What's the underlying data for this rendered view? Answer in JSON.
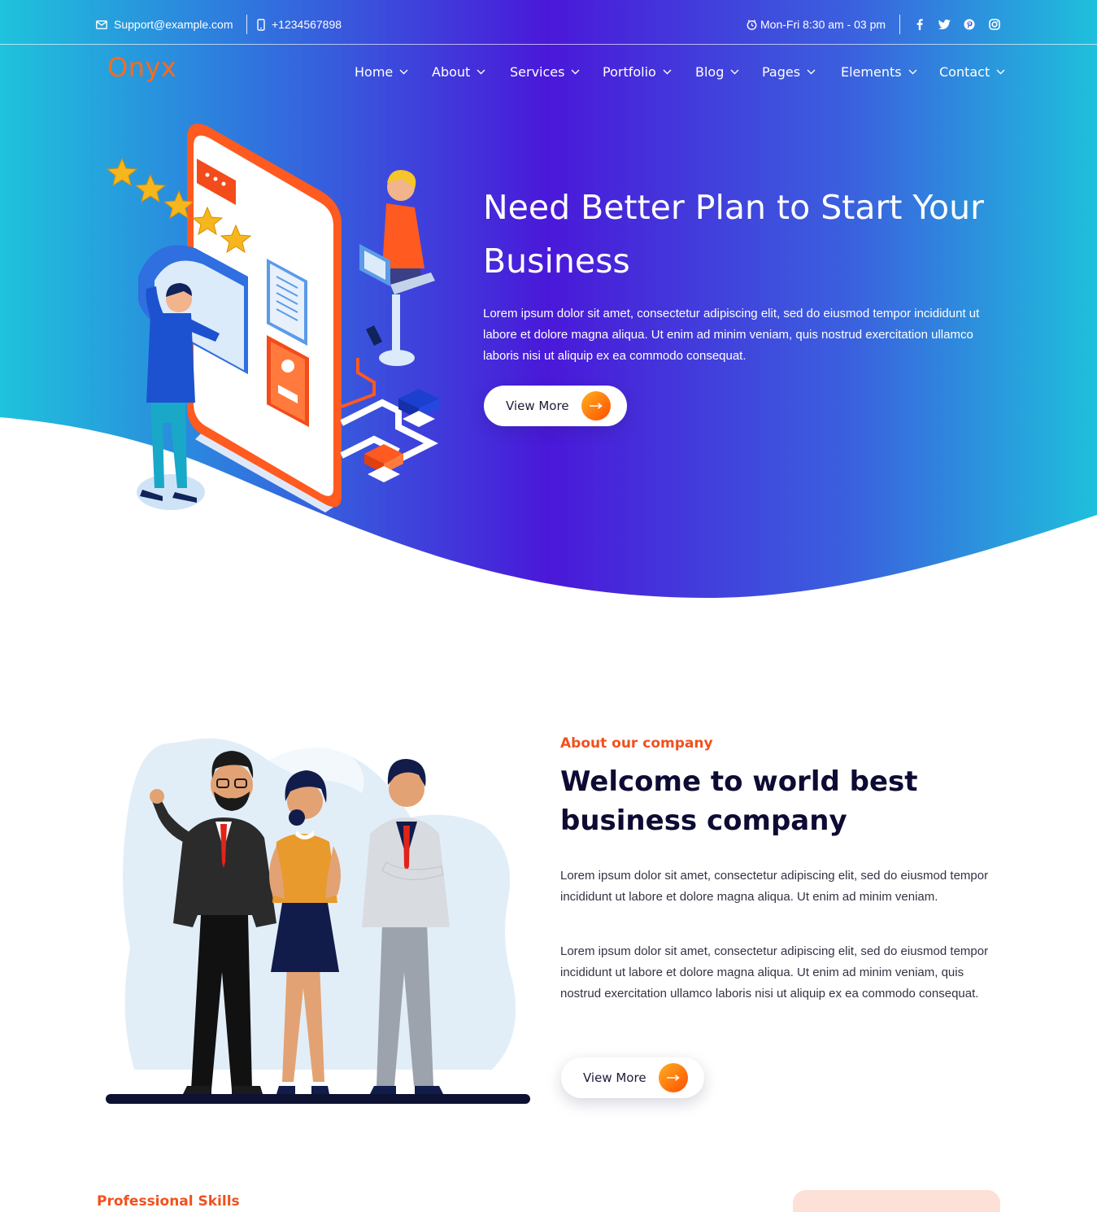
{
  "topbar": {
    "email": "Support@example.com",
    "phone": "+1234567898",
    "hours": "Mon-Fri 8:30 am - 03 pm",
    "social": [
      "facebook-icon",
      "twitter-icon",
      "pinterest-icon",
      "instagram-icon"
    ]
  },
  "logo": "Onyx",
  "nav": {
    "items": [
      {
        "label": "Home"
      },
      {
        "label": "About"
      },
      {
        "label": "Services"
      },
      {
        "label": "Portfolio"
      },
      {
        "label": "Blog"
      },
      {
        "label": "Pages"
      },
      {
        "label": "Elements"
      },
      {
        "label": "Contact"
      }
    ]
  },
  "hero": {
    "title": "Need Better Plan to Start Your Business",
    "text": "Lorem ipsum dolor sit amet, consectetur adipiscing elit, sed do eiusmod tempor incididunt ut labore et dolore magna aliqua. Ut enim ad minim veniam, quis nostrud exercitation ullamco laboris nisi ut aliquip ex ea commodo consequat.",
    "button": "View More"
  },
  "about": {
    "eyebrow": "About our company",
    "title": "Welcome to world best business company",
    "para1": "Lorem ipsum dolor sit amet, consectetur adipiscing elit, sed do eiusmod tempor incididunt ut labore et dolore magna aliqua. Ut enim ad minim veniam.",
    "para2": "Lorem ipsum dolor sit amet, consectetur adipiscing elit, sed do eiusmod tempor incididunt ut labore et dolore magna aliqua. Ut enim ad minim veniam, quis nostrud exercitation ullamco laboris nisi ut aliquip ex ea commodo consequat.",
    "button": "View More"
  },
  "skills": {
    "eyebrow": "Professional Skills"
  },
  "colors": {
    "accent": "#ff5a1f",
    "gradient_start": "#1ec3dc",
    "gradient_mid": "#4a1ad8",
    "heading": "#0d0b33"
  }
}
